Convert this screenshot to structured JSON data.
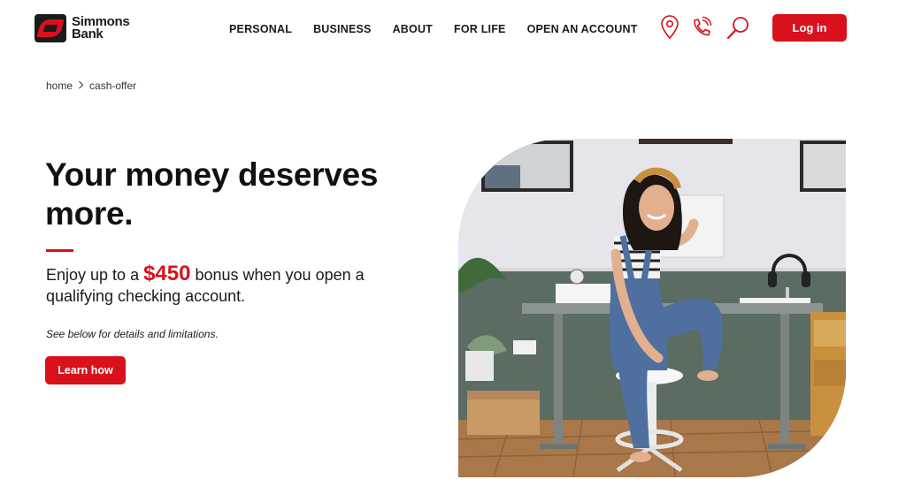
{
  "brand": {
    "name_line1": "Simmons",
    "name_line2": "Bank",
    "accent": "#d8111c"
  },
  "nav": {
    "items": [
      {
        "label": "PERSONAL"
      },
      {
        "label": "BUSINESS"
      },
      {
        "label": "ABOUT"
      },
      {
        "label": "FOR LIFE"
      },
      {
        "label": "OPEN AN ACCOUNT"
      }
    ],
    "icons": [
      "location-pin-icon",
      "phone-icon",
      "search-icon"
    ],
    "login_label": "Log in"
  },
  "breadcrumb": {
    "items": [
      "home",
      "cash-offer"
    ],
    "separator_icon": "chevron-right-icon"
  },
  "hero": {
    "title": "Your money deserves more.",
    "subtitle_before": "Enjoy up to a ",
    "subtitle_amount": "$450",
    "subtitle_after": " bonus when you open a qualifying checking account.",
    "disclaimer": "See below for details and limitations.",
    "cta_label": "Learn how",
    "image_alt": "Smiling woman sitting on a stool beside a desk in a home office"
  }
}
